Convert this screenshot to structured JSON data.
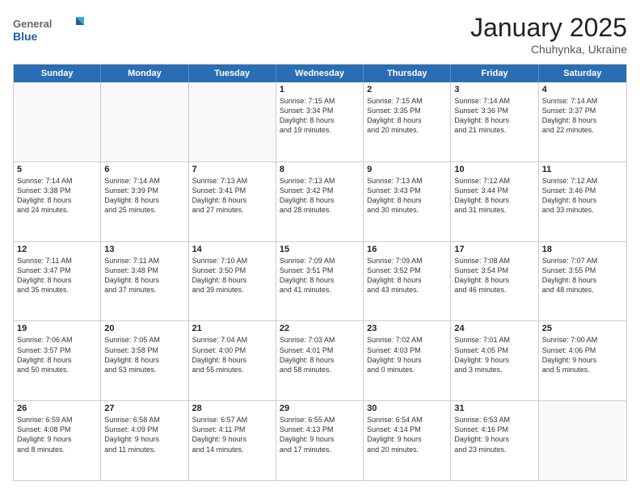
{
  "header": {
    "logo_general": "General",
    "logo_blue": "Blue",
    "month": "January 2025",
    "location": "Chuhynka, Ukraine"
  },
  "days_of_week": [
    "Sunday",
    "Monday",
    "Tuesday",
    "Wednesday",
    "Thursday",
    "Friday",
    "Saturday"
  ],
  "weeks": [
    [
      {
        "day": "",
        "text": ""
      },
      {
        "day": "",
        "text": ""
      },
      {
        "day": "",
        "text": ""
      },
      {
        "day": "1",
        "text": "Sunrise: 7:15 AM\nSunset: 3:34 PM\nDaylight: 8 hours\nand 19 minutes."
      },
      {
        "day": "2",
        "text": "Sunrise: 7:15 AM\nSunset: 3:35 PM\nDaylight: 8 hours\nand 20 minutes."
      },
      {
        "day": "3",
        "text": "Sunrise: 7:14 AM\nSunset: 3:36 PM\nDaylight: 8 hours\nand 21 minutes."
      },
      {
        "day": "4",
        "text": "Sunrise: 7:14 AM\nSunset: 3:37 PM\nDaylight: 8 hours\nand 22 minutes."
      }
    ],
    [
      {
        "day": "5",
        "text": "Sunrise: 7:14 AM\nSunset: 3:38 PM\nDaylight: 8 hours\nand 24 minutes."
      },
      {
        "day": "6",
        "text": "Sunrise: 7:14 AM\nSunset: 3:39 PM\nDaylight: 8 hours\nand 25 minutes."
      },
      {
        "day": "7",
        "text": "Sunrise: 7:13 AM\nSunset: 3:41 PM\nDaylight: 8 hours\nand 27 minutes."
      },
      {
        "day": "8",
        "text": "Sunrise: 7:13 AM\nSunset: 3:42 PM\nDaylight: 8 hours\nand 28 minutes."
      },
      {
        "day": "9",
        "text": "Sunrise: 7:13 AM\nSunset: 3:43 PM\nDaylight: 8 hours\nand 30 minutes."
      },
      {
        "day": "10",
        "text": "Sunrise: 7:12 AM\nSunset: 3:44 PM\nDaylight: 8 hours\nand 31 minutes."
      },
      {
        "day": "11",
        "text": "Sunrise: 7:12 AM\nSunset: 3:46 PM\nDaylight: 8 hours\nand 33 minutes."
      }
    ],
    [
      {
        "day": "12",
        "text": "Sunrise: 7:11 AM\nSunset: 3:47 PM\nDaylight: 8 hours\nand 35 minutes."
      },
      {
        "day": "13",
        "text": "Sunrise: 7:11 AM\nSunset: 3:48 PM\nDaylight: 8 hours\nand 37 minutes."
      },
      {
        "day": "14",
        "text": "Sunrise: 7:10 AM\nSunset: 3:50 PM\nDaylight: 8 hours\nand 39 minutes."
      },
      {
        "day": "15",
        "text": "Sunrise: 7:09 AM\nSunset: 3:51 PM\nDaylight: 8 hours\nand 41 minutes."
      },
      {
        "day": "16",
        "text": "Sunrise: 7:09 AM\nSunset: 3:52 PM\nDaylight: 8 hours\nand 43 minutes."
      },
      {
        "day": "17",
        "text": "Sunrise: 7:08 AM\nSunset: 3:54 PM\nDaylight: 8 hours\nand 46 minutes."
      },
      {
        "day": "18",
        "text": "Sunrise: 7:07 AM\nSunset: 3:55 PM\nDaylight: 8 hours\nand 48 minutes."
      }
    ],
    [
      {
        "day": "19",
        "text": "Sunrise: 7:06 AM\nSunset: 3:57 PM\nDaylight: 8 hours\nand 50 minutes."
      },
      {
        "day": "20",
        "text": "Sunrise: 7:05 AM\nSunset: 3:58 PM\nDaylight: 8 hours\nand 53 minutes."
      },
      {
        "day": "21",
        "text": "Sunrise: 7:04 AM\nSunset: 4:00 PM\nDaylight: 8 hours\nand 55 minutes."
      },
      {
        "day": "22",
        "text": "Sunrise: 7:03 AM\nSunset: 4:01 PM\nDaylight: 8 hours\nand 58 minutes."
      },
      {
        "day": "23",
        "text": "Sunrise: 7:02 AM\nSunset: 4:03 PM\nDaylight: 9 hours\nand 0 minutes."
      },
      {
        "day": "24",
        "text": "Sunrise: 7:01 AM\nSunset: 4:05 PM\nDaylight: 9 hours\nand 3 minutes."
      },
      {
        "day": "25",
        "text": "Sunrise: 7:00 AM\nSunset: 4:06 PM\nDaylight: 9 hours\nand 5 minutes."
      }
    ],
    [
      {
        "day": "26",
        "text": "Sunrise: 6:59 AM\nSunset: 4:08 PM\nDaylight: 9 hours\nand 8 minutes."
      },
      {
        "day": "27",
        "text": "Sunrise: 6:58 AM\nSunset: 4:09 PM\nDaylight: 9 hours\nand 11 minutes."
      },
      {
        "day": "28",
        "text": "Sunrise: 6:57 AM\nSunset: 4:11 PM\nDaylight: 9 hours\nand 14 minutes."
      },
      {
        "day": "29",
        "text": "Sunrise: 6:55 AM\nSunset: 4:13 PM\nDaylight: 9 hours\nand 17 minutes."
      },
      {
        "day": "30",
        "text": "Sunrise: 6:54 AM\nSunset: 4:14 PM\nDaylight: 9 hours\nand 20 minutes."
      },
      {
        "day": "31",
        "text": "Sunrise: 6:53 AM\nSunset: 4:16 PM\nDaylight: 9 hours\nand 23 minutes."
      },
      {
        "day": "",
        "text": ""
      }
    ]
  ]
}
